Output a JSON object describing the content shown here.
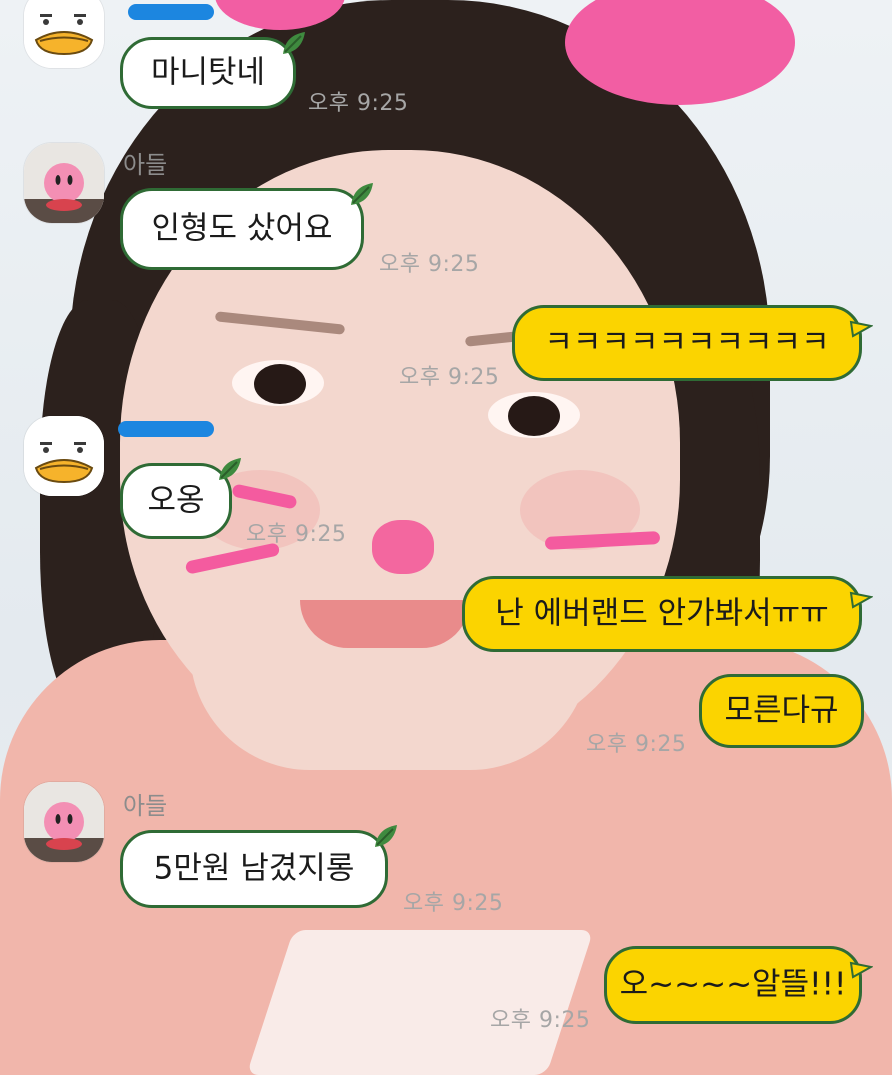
{
  "messages": [
    {
      "id": "m1",
      "side": "in",
      "text": "마니탓네",
      "time": "오후 9:25"
    },
    {
      "id": "m2",
      "side": "in",
      "sender": "아들",
      "text": "인형도 샀어요",
      "time": "오후 9:25"
    },
    {
      "id": "m3",
      "side": "out",
      "text": "ㅋㅋㅋㅋㅋㅋㅋㅋㅋㅋ",
      "time": "오후 9:25"
    },
    {
      "id": "m4",
      "side": "in",
      "text": "오옹",
      "time": "오후 9:25"
    },
    {
      "id": "m5",
      "side": "out",
      "text": "난 에버랜드 안가봐서ㅠㅠ"
    },
    {
      "id": "m6",
      "side": "out",
      "text": "모른다규",
      "time": "오후 9:25"
    },
    {
      "id": "m7",
      "side": "in",
      "sender": "아들",
      "text": "5만원 남겼지롱",
      "time": "오후 9:25"
    },
    {
      "id": "m8",
      "side": "out",
      "text": "오~~~~알뜰!!!",
      "time": "오후 9:25"
    }
  ],
  "avatars": {
    "duck": "duck-avatar-icon",
    "kirby": "pink-plush-avatar-icon"
  },
  "colors": {
    "incoming_bubble": "#ffffff",
    "outgoing_bubble": "#fbd400",
    "bubble_border": "#2f6b35",
    "leaf": "#3f8a3f",
    "timestamp": "#a6a6a6",
    "sender_name": "#8c8c8c"
  }
}
